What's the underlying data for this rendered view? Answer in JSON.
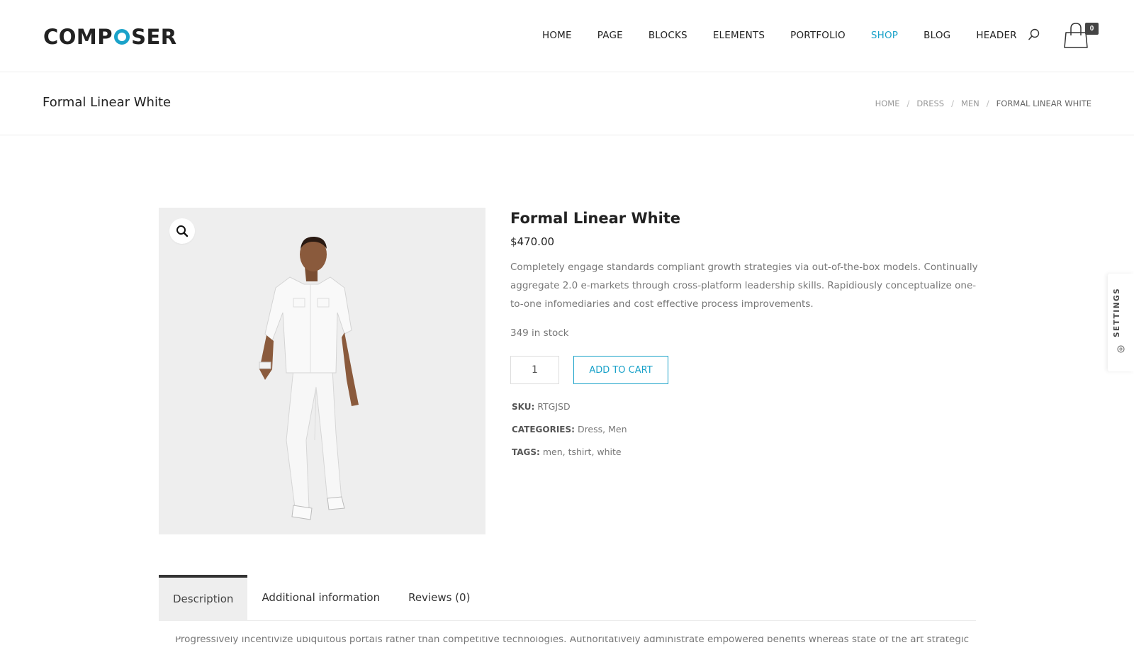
{
  "header": {
    "logo_left": "COMP",
    "logo_right": "SER",
    "nav": [
      {
        "label": "HOME",
        "active": false
      },
      {
        "label": "PAGE",
        "active": false
      },
      {
        "label": "BLOCKS",
        "active": false
      },
      {
        "label": "ELEMENTS",
        "active": false
      },
      {
        "label": "PORTFOLIO",
        "active": false
      },
      {
        "label": "SHOP",
        "active": true
      },
      {
        "label": "BLOG",
        "active": false
      },
      {
        "label": "HEADER",
        "active": false
      }
    ],
    "search_icon": "search-icon",
    "cart_icon": "shopping-bag-icon",
    "cart_count": "0"
  },
  "titlebar": {
    "title": "Formal Linear White",
    "breadcrumb": [
      "HOME",
      "DRESS",
      "MEN",
      "FORMAL LINEAR WHITE"
    ],
    "separator": "/"
  },
  "product": {
    "title": "Formal Linear White",
    "price": "$470.00",
    "description": "Completely engage standards compliant growth strategies via out-of-the-box models. Continually aggregate 2.0 e-markets through cross-platform leadership skills. Rapidiously conceptualize one-to-one infomediaries and cost effective process improvements.",
    "stock": "349 in stock",
    "quantity": "1",
    "add_to_cart": "ADD TO CART",
    "sku_label": "SKU:",
    "sku": "RTGJSD",
    "categories_label": "CATEGORIES:",
    "categories": [
      "Dress",
      "Men"
    ],
    "tags_label": "TAGS:",
    "tags": [
      "men",
      "tshirt",
      "white"
    ],
    "zoom_icon": "magnifier-zoom-icon"
  },
  "settings": {
    "label": "SETTINGS",
    "icon": "gear-icon"
  },
  "tabs": [
    {
      "label": "Description",
      "active": true
    },
    {
      "label": "Additional information",
      "active": false
    },
    {
      "label": "Reviews (0)",
      "active": false
    }
  ],
  "tab_content": "Progressively incentivize ubiquitous portals rather than competitive technologies. Authoritatively administrate empowered benefits whereas state of the art strategic",
  "colors": {
    "accent": "#1aa2c9",
    "text": "#222222",
    "muted": "#777777",
    "image_bg": "#eeeeee"
  }
}
